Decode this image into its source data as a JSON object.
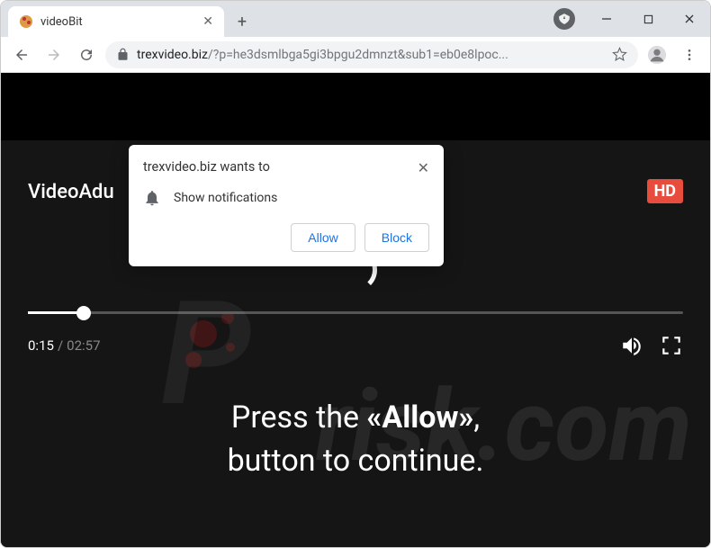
{
  "tab": {
    "title": "videoBit"
  },
  "toolbar": {
    "url_domain": "trexvideo.biz",
    "url_path": "/?p=he3dsmlbga5gi3bpgu2dmnzt&sub1=eb0e8lpoc..."
  },
  "permission": {
    "origin": "trexvideo.biz wants to",
    "description": "Show notifications",
    "allow": "Allow",
    "block": "Block"
  },
  "player": {
    "brand": "VideoAdu",
    "hd": "HD",
    "current": "0:15",
    "total": "02:57",
    "progress_pct": 8.5
  },
  "message": {
    "line1_pre": "Press the ",
    "line1_bold": "«Allow»",
    "line1_post": ",",
    "line2": "button to continue."
  },
  "watermark": {
    "risk": "risk.com",
    "p": "P"
  }
}
